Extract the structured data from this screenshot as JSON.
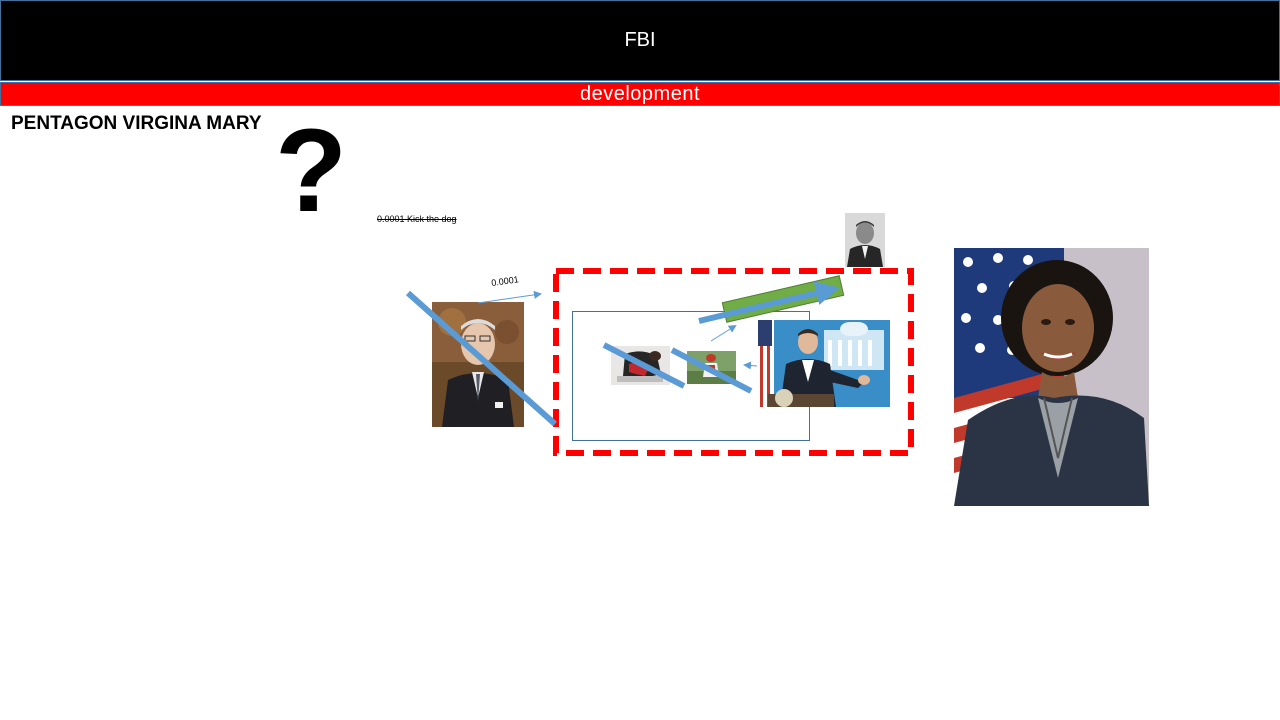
{
  "header": {
    "title": "FBI"
  },
  "subheader": {
    "label": "development"
  },
  "slide": {
    "title": "PENTAGON VIRGINA MARY",
    "symbol": "?",
    "struck_note": "0.0001 Kick the dog",
    "arrow_label": "0.0001"
  },
  "colors": {
    "header_bg": "#000000",
    "subheader_bg": "#ff0000",
    "border": "#41719c",
    "dashed_frame": "#ff0000",
    "connector": "#5b9bd5",
    "green_block": "#70ad47"
  }
}
